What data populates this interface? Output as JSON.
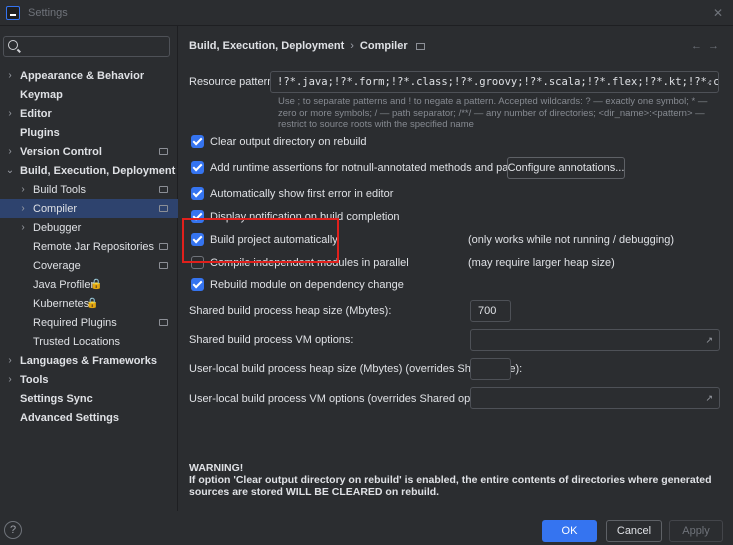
{
  "window": {
    "title": "Settings",
    "close": "✕"
  },
  "sidebar": {
    "items": [
      {
        "label": "Appearance & Behavior",
        "bold": true,
        "chevron": "›",
        "level": 0
      },
      {
        "label": "Keymap",
        "bold": true,
        "level": 0
      },
      {
        "label": "Editor",
        "bold": true,
        "chevron": "›",
        "level": 0
      },
      {
        "label": "Plugins",
        "bold": true,
        "level": 0
      },
      {
        "label": "Version Control",
        "bold": true,
        "chevron": "›",
        "level": 0,
        "trailing": "project-icon"
      },
      {
        "label": "Build, Execution, Deployment",
        "bold": true,
        "chevron": "⌄",
        "level": 0
      },
      {
        "label": "Build Tools",
        "chevron": "›",
        "level": 1,
        "trailing": "project-icon"
      },
      {
        "label": "Compiler",
        "chevron": "›",
        "level": 1,
        "selected": true,
        "trailing": "project-icon"
      },
      {
        "label": "Debugger",
        "chevron": "›",
        "level": 1
      },
      {
        "label": "Remote Jar Repositories",
        "level": 1,
        "trailing": "project-icon"
      },
      {
        "label": "Coverage",
        "level": 1,
        "trailing": "project-icon"
      },
      {
        "label": "Java Profiler",
        "level": 1,
        "lock": "🔒"
      },
      {
        "label": "Kubernetes",
        "level": 1,
        "lock": "🔒"
      },
      {
        "label": "Required Plugins",
        "level": 1,
        "trailing": "project-icon"
      },
      {
        "label": "Trusted Locations",
        "level": 1
      },
      {
        "label": "Languages & Frameworks",
        "bold": true,
        "chevron": "›",
        "level": 0
      },
      {
        "label": "Tools",
        "bold": true,
        "chevron": "›",
        "level": 0
      },
      {
        "label": "Settings Sync",
        "bold": true,
        "level": 0
      },
      {
        "label": "Advanced Settings",
        "bold": true,
        "level": 0
      }
    ]
  },
  "breadcrumb": {
    "parent": "Build, Execution, Deployment",
    "sep": "›",
    "current": "Compiler"
  },
  "nav": {
    "back": "←",
    "forward": "→"
  },
  "resource": {
    "label": "Resource patterns:",
    "value": "!?*.java;!?*.form;!?*.class;!?*.groovy;!?*.scala;!?*.flex;!?*.kt;!?*.clj;!?*.aj",
    "hint": "Use ; to separate patterns and ! to negate a pattern. Accepted wildcards: ? — exactly one symbol; * — zero or more symbols; / — path separator; /**/ — any number of directories; <dir_name>:<pattern> — restrict to source roots with the specified name"
  },
  "options": [
    {
      "label": "Clear output directory on rebuild",
      "checked": true
    },
    {
      "label": "Add runtime assertions for notnull-annotated methods and parameters",
      "checked": true
    },
    {
      "label": "Automatically show first error in editor",
      "checked": true
    },
    {
      "label": "Display notification on build completion",
      "checked": true
    },
    {
      "label": "Build project automatically",
      "checked": true,
      "note": "(only works while not running / debugging)"
    },
    {
      "label": "Compile independent modules in parallel",
      "checked": false,
      "note": "(may require larger heap size)"
    },
    {
      "label": "Rebuild module on dependency change",
      "checked": true
    }
  ],
  "configure_button": "Configure annotations...",
  "fields": {
    "heap_label": "Shared build process heap size (Mbytes):",
    "heap_value": "700",
    "vm_label": "Shared build process VM options:",
    "user_heap_label": "User-local build process heap size (Mbytes) (overrides Shared size):",
    "user_vm_label": "User-local build process VM options (overrides Shared options):",
    "expand": "↗"
  },
  "warning": {
    "title": "WARNING!",
    "text": "If option 'Clear output directory on rebuild' is enabled, the entire contents of directories where generated sources are stored WILL BE CLEARED on rebuild."
  },
  "footer": {
    "help": "?",
    "ok": "OK",
    "cancel": "Cancel",
    "apply": "Apply"
  },
  "colors": {
    "accent": "#3574f0",
    "highlight_box": "#e0201c",
    "background": "#2b2d30"
  }
}
